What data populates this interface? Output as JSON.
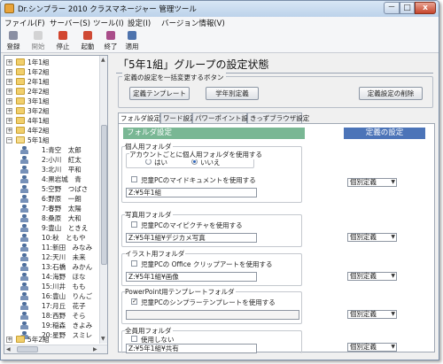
{
  "window": {
    "title": "Dr.シンプラー 2010 クラスマネージャー 管理ツール",
    "min_label": "－",
    "max_label": "□",
    "close_label": "x"
  },
  "menu": [
    {
      "label": "ファイル(F)"
    },
    {
      "label": "サーバー(S)"
    },
    {
      "label": "ツール(I)"
    },
    {
      "label": "設定(I)"
    },
    {
      "label": "バージョン情報(V)"
    }
  ],
  "toolbar": {
    "items": [
      {
        "label": "登録",
        "icon": "register-icon",
        "color": "#8a8fa3"
      },
      {
        "label": "開始",
        "icon": "start-icon",
        "color": "#b8b8b8"
      },
      {
        "label": "停止",
        "icon": "stop-icon",
        "color": "#d2452f"
      },
      {
        "label": "起動",
        "icon": "launch-icon",
        "color": "#cf4a35"
      },
      {
        "label": "終了",
        "icon": "exit-icon",
        "color": "#a94d8a"
      },
      {
        "label": "適用",
        "icon": "apply-icon",
        "color": "#4e73ad"
      }
    ]
  },
  "tree": {
    "groups": [
      {
        "expand": "+",
        "label": "1年1組"
      },
      {
        "expand": "+",
        "label": "1年2組"
      },
      {
        "expand": "+",
        "label": "2年1組"
      },
      {
        "expand": "+",
        "label": "2年2組"
      },
      {
        "expand": "+",
        "label": "3年1組"
      },
      {
        "expand": "+",
        "label": "3年2組"
      },
      {
        "expand": "+",
        "label": "4年1組"
      },
      {
        "expand": "+",
        "label": "4年2組"
      },
      {
        "expand": "−",
        "label": "5年1組"
      }
    ],
    "students": [
      "1:青空　太郎",
      "2:小川　紅太",
      "3:北川　平和",
      "4:黒岩城　青",
      "5:空野　つばさ",
      "6:野原　一朗",
      "7:春野　太陽",
      "8:桑原　大和",
      "9:豊山　ときえ",
      "10:秋　ともや",
      "11:新田　みなみ",
      "12:天川　未来",
      "13:石橋　みかん",
      "14:海野　ほな",
      "15:川井　もも",
      "16:豊山　りんご",
      "17:月丘　花子",
      "18:西野　そら",
      "19:稲森　きよみ",
      "20:星野　スミレ"
    ],
    "last_group": {
      "expand": "+",
      "label": "5年2組"
    }
  },
  "main": {
    "group_title": "「5年1組」グループの設定状態",
    "bulk_label": "定義の設定を一括変更するボタン",
    "buttons": {
      "template": "定義テンプレート",
      "gakunen": "学年別定義",
      "delete": "定義設定の削除"
    },
    "tabs": [
      "フォルダ設定",
      "ワード設定",
      "パワーポイント設定",
      "きっずブラウザ設定"
    ],
    "folder_header": "フォルダ設定",
    "teigi_header": "定義の設定",
    "personal": {
      "label": "個人用フォルダ",
      "sub_label": "アカウントごとに個人用フォルダを使用する",
      "radio_no": "はい",
      "radio_yes": "いいえ",
      "mydoc_label": "児童PCのマイドキュメントを使用する",
      "path": "Z:¥5年1組",
      "select": "個別定義"
    },
    "photo": {
      "label": "写真用フォルダ",
      "check_label": "児童PCのマイピクチャを使用する",
      "path": "Z:¥5年1組¥デジカメ写真",
      "select": "個別定義"
    },
    "illust": {
      "label": "イラスト用フォルダ",
      "check_label": "児童PCの Office クリップアートを使用する",
      "path": "Z:¥5年1組¥画像",
      "select": "個別定義"
    },
    "ppt": {
      "label": "PowerPoint用テンプレートフォルダ",
      "check_label": "児童PCのシンプラーテンプレートを使用する",
      "path": "",
      "select": "個別定義"
    },
    "shared": {
      "label": "全員用フォルダ",
      "check_label": "使用しない",
      "path": "Z:¥5年1組¥共有",
      "select": "個別定義"
    }
  },
  "scroll": {
    "up": "▲",
    "down": "▼",
    "left": "◀",
    "right": "▶"
  }
}
